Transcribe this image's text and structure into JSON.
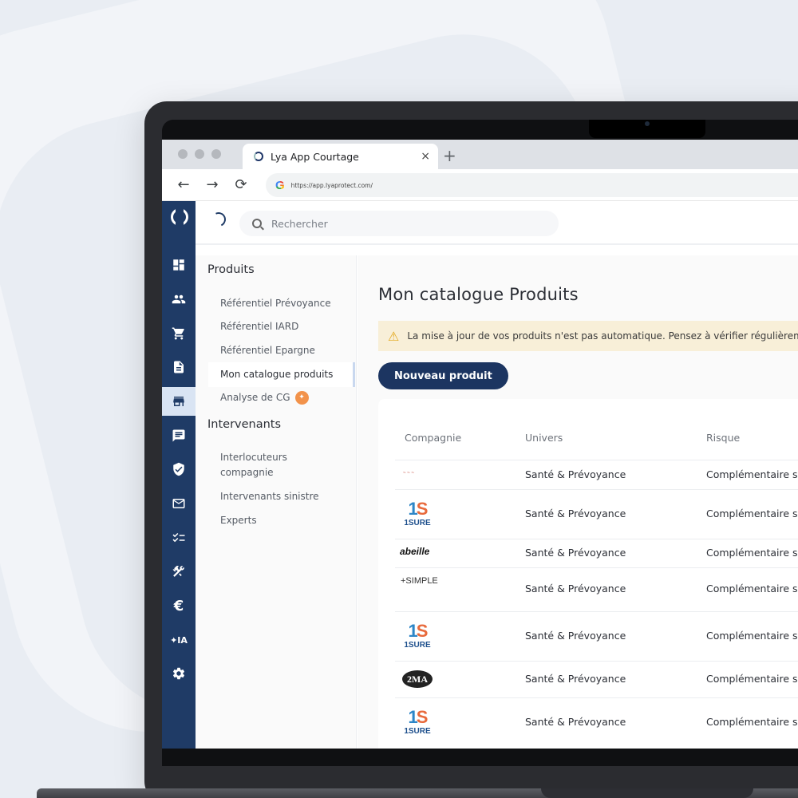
{
  "browser": {
    "tab_title": "Lya App Courtage",
    "tab_close": "×",
    "new_tab": "+",
    "back": "←",
    "forward": "→",
    "reload": "⟳",
    "google": "G",
    "url": "https://app.lyaprotect.com/"
  },
  "search": {
    "placeholder": "Rechercher"
  },
  "rail": {
    "icons": [
      "dashboard-icon",
      "people-icon",
      "cart-icon",
      "document-icon",
      "store-icon",
      "chat-icon",
      "shield-check-icon",
      "mail-icon",
      "checklist-icon",
      "tools-icon",
      "euro-icon",
      "ai-sparkle-icon",
      "gear-icon"
    ],
    "euro": "€",
    "ai": "✦IA",
    "active_index": 4
  },
  "subnav": {
    "products_heading": "Produits",
    "products_items": [
      "Référentiel Prévoyance",
      "Référentiel IARD",
      "Référentiel Epargne",
      "Mon catalogue produits",
      "Analyse de CG"
    ],
    "intervenants_heading": "Intervenants",
    "intervenants_items": [
      "Interlocuteurs compagnie",
      "Intervenants sinistre",
      "Experts"
    ],
    "ai_badge": "✦"
  },
  "main": {
    "title": "Mon catalogue Produits",
    "alert": "La mise à jour de vos produits n'est pas automatique. Pensez à vérifier régulièrement",
    "alert_icon": "⚠",
    "new_button": "Nouveau produit"
  },
  "table": {
    "headers": [
      "Compagnie",
      "Univers",
      "Risque"
    ],
    "rows": [
      {
        "logo": "tiny",
        "logo_text": "~ ~ ~",
        "univers": "Santé & Prévoyance",
        "risque": "Complémentaire santé"
      },
      {
        "logo": "1sure",
        "logo_text": "1SURE",
        "univers": "Santé & Prévoyance",
        "risque": "Complémentaire santé"
      },
      {
        "logo": "abeille",
        "logo_text": "abeille",
        "univers": "Santé & Prévoyance",
        "risque": "Complémentaire santé"
      },
      {
        "logo": "broken",
        "logo_text": "+SIMPLE",
        "univers": "Santé & Prévoyance",
        "risque": "Complémentaire santé"
      },
      {
        "logo": "1sure",
        "logo_text": "1SURE",
        "univers": "Santé & Prévoyance",
        "risque": "Complémentaire santé"
      },
      {
        "logo": "2ma",
        "logo_text": "2MA",
        "univers": "Santé & Prévoyance",
        "risque": "Complémentaire santé"
      },
      {
        "logo": "1sure",
        "logo_text": "1SURE",
        "univers": "Santé & Prévoyance",
        "risque": "Complémentaire santé"
      }
    ]
  },
  "colors": {
    "rail": "#1f3b66",
    "primary": "#1c3561",
    "alert_bg": "#f8efd8",
    "ai_badge": "#f2924a"
  }
}
